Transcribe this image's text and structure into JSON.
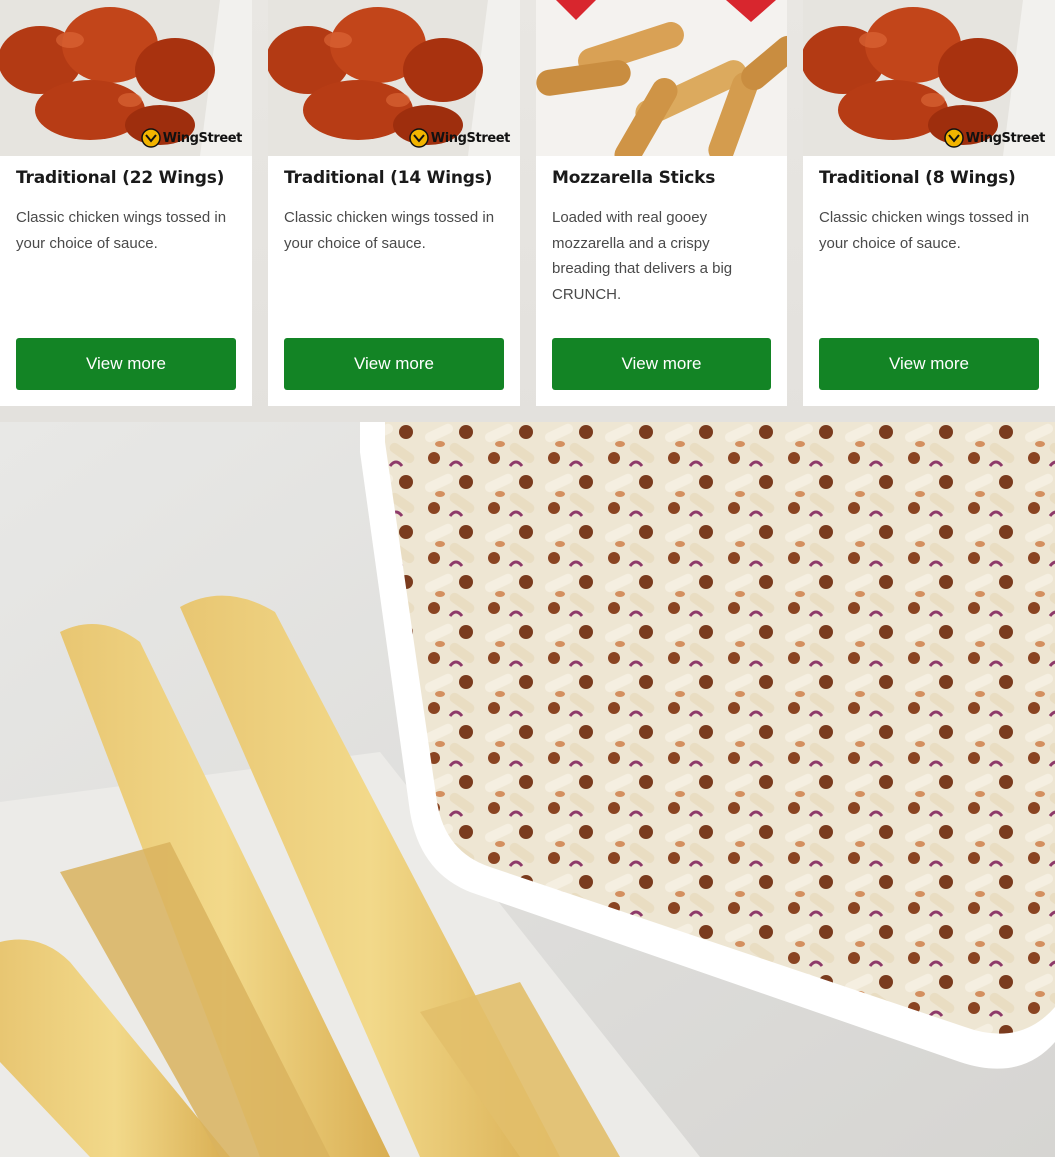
{
  "cards": [
    {
      "title": "Traditional (22 Wings)",
      "description": "Classic chicken wings tossed in your choice of sauce.",
      "button_label": "View more",
      "image_icon": "chicken-wings-image",
      "badge_text": "WingStreet"
    },
    {
      "title": "Traditional (14 Wings)",
      "description": "Classic chicken wings tossed in your choice of sauce.",
      "button_label": "View more",
      "image_icon": "chicken-wings-image",
      "badge_text": "WingStreet"
    },
    {
      "title": "Mozzarella Sticks",
      "description": "Loaded with real gooey mozzarella and a crispy breading that delivers a big CRUNCH.",
      "button_label": "View more",
      "image_icon": "mozzarella-sticks-image"
    },
    {
      "title": "Traditional (8 Wings)",
      "description": "Classic chicken wings tossed in your choice of sauce.",
      "button_label": "View more",
      "image_icon": "chicken-wings-image",
      "badge_text": "WingStreet"
    }
  ],
  "hero": {
    "image_icon": "pasta-and-breadsticks-image"
  },
  "colors": {
    "button_green": "#138425",
    "card_background": "#ffffff",
    "page_background": "#eceae6"
  }
}
